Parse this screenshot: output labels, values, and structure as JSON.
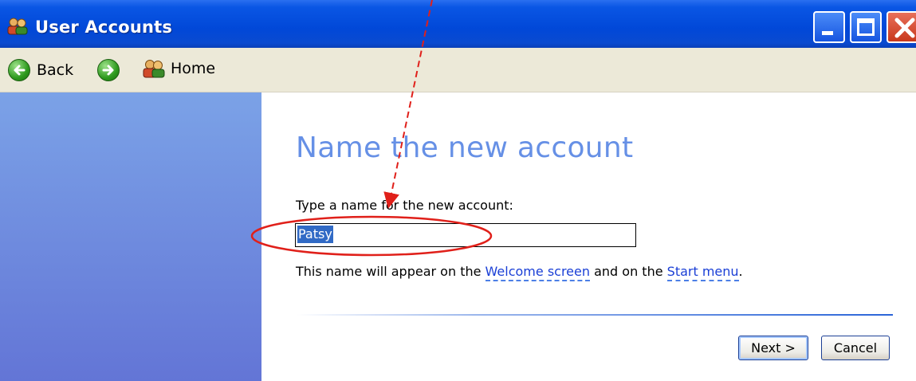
{
  "window": {
    "title": "User Accounts",
    "controls": [
      "minimize",
      "maximize",
      "close"
    ]
  },
  "navbar": {
    "back_label": "Back",
    "home_label": "Home"
  },
  "main": {
    "heading": "Name the new account",
    "prompt": "Type a name for the new account:",
    "name_value": "Patsy",
    "info_pre": "This name will appear on the ",
    "info_link1": "Welcome screen",
    "info_mid": " and on the ",
    "info_link2": "Start menu",
    "info_post": "."
  },
  "buttons": {
    "next_label": "Next >",
    "cancel_label": "Cancel"
  },
  "annotation": {
    "color": "#e0201a"
  }
}
